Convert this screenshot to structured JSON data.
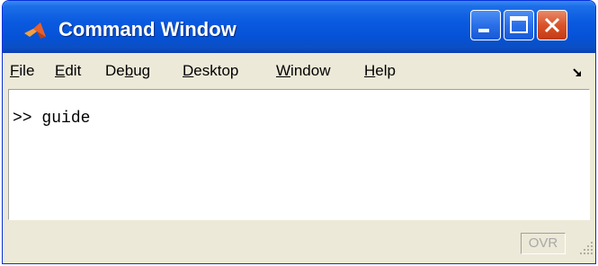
{
  "window": {
    "title": "Command Window",
    "title_icon": "matlab-logo-icon",
    "controls": [
      "minimize-icon",
      "maximize-icon",
      "close-icon"
    ]
  },
  "menubar": {
    "items": [
      {
        "pre": "",
        "u": "F",
        "post": "ile"
      },
      {
        "pre": "",
        "u": "E",
        "post": "dit"
      },
      {
        "pre": "De",
        "u": "b",
        "post": "ug"
      },
      {
        "pre": "",
        "u": "D",
        "post": "esktop"
      },
      {
        "pre": "",
        "u": "W",
        "post": "indow"
      },
      {
        "pre": "",
        "u": "H",
        "post": "elp"
      }
    ],
    "undock_icon": "undock-arrow-icon"
  },
  "console": {
    "prompt": ">>",
    "command": "guide"
  },
  "statusbar": {
    "ovr_label": "OVR",
    "grip_icon": "resize-grip-icon"
  },
  "colors": {
    "titlebar": "#0552d6",
    "chrome": "#ece9d8",
    "close_button": "#d9532a"
  }
}
